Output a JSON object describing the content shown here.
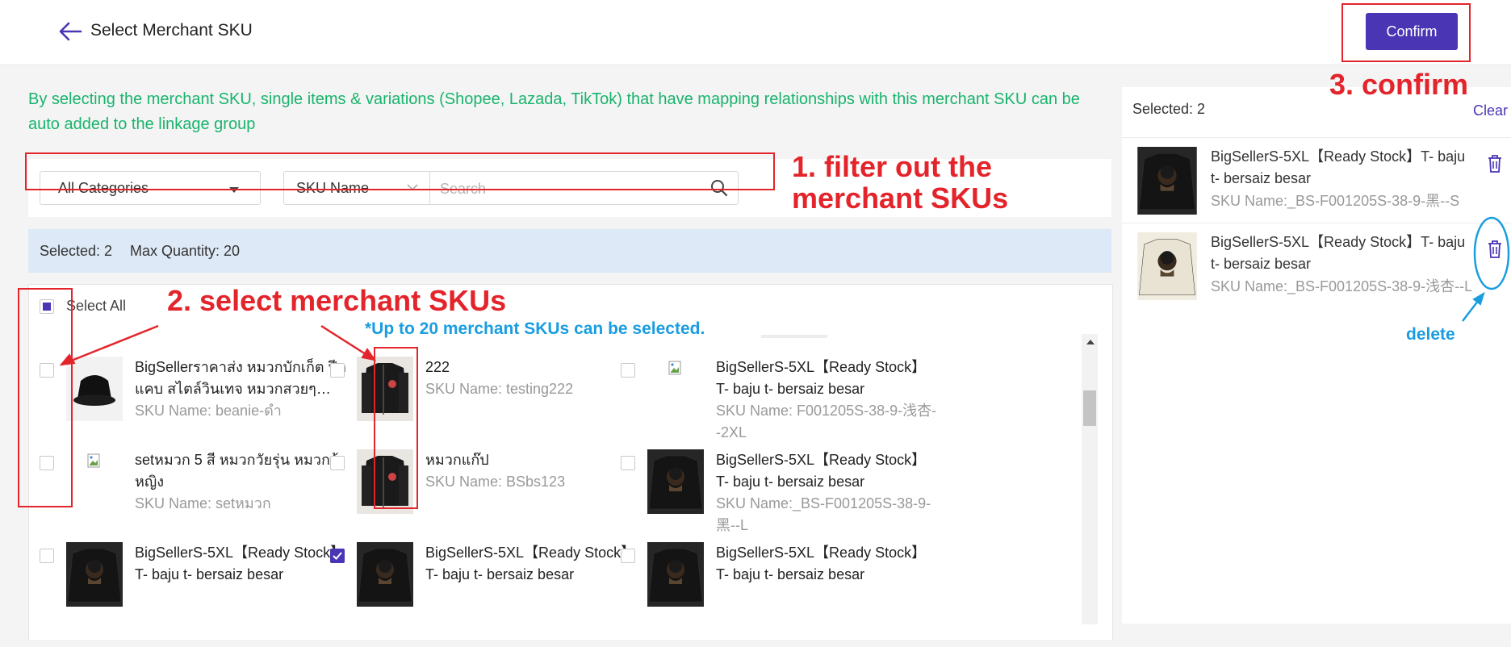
{
  "header": {
    "title": "Select Merchant SKU",
    "confirm_label": "Confirm"
  },
  "note": "By selecting the merchant SKU, single items & variations (Shopee, Lazada, TikTok) that have mapping relationships with this merchant SKU can be auto added to the linkage group",
  "filters": {
    "category": "All Categories",
    "search_type": "SKU Name",
    "search_placeholder": "Search"
  },
  "info_bar": {
    "selected": "Selected: 2",
    "max_quantity": "Max Quantity: 20"
  },
  "select_all_label": "Select All",
  "items": [
    {
      "name": "BigSellerราคาส่ง หมวกบักเก็ต ปีกแคบ สไตล์วินเทจ หมวกสวยๆ…",
      "sku": "SKU Name: beanie-ดำ",
      "checked": false,
      "thumb": "hat"
    },
    {
      "name": "222",
      "sku": "SKU Name: testing222",
      "checked": false,
      "thumb": "jacket"
    },
    {
      "name": "BigSellerS-5XL【Ready Stock】T- baju t- bersaiz besar",
      "sku": "SKU Name: F001205S-38-9-浅杏--2XL",
      "checked": false,
      "thumb": "broken"
    },
    {
      "name": "setหมวก 5 สี หมวกวัยรุ่น หมวกผู้หญิง",
      "sku": "SKU Name: setหมวก",
      "checked": false,
      "thumb": "broken"
    },
    {
      "name": "หมวกแก๊ป",
      "sku": "SKU Name: BSbs123",
      "checked": false,
      "thumb": "jacket"
    },
    {
      "name": "BigSellerS-5XL【Ready Stock】T- baju t- bersaiz besar",
      "sku": "SKU Name:_BS-F001205S-38-9-黑--L",
      "checked": false,
      "thumb": "shirt-black"
    },
    {
      "name": "BigSellerS-5XL【Ready Stock】T- baju t- bersaiz besar",
      "sku": "",
      "checked": false,
      "thumb": "shirt-black"
    },
    {
      "name": "BigSellerS-5XL【Ready Stock】T- baju t- bersaiz besar",
      "sku": "",
      "checked": true,
      "thumb": "shirt-black"
    },
    {
      "name": "BigSellerS-5XL【Ready Stock】T- baju t- bersaiz besar",
      "sku": "",
      "checked": false,
      "thumb": "shirt-black"
    }
  ],
  "selected_panel": {
    "count_label": "Selected: 2",
    "clear_label": "Clear",
    "items": [
      {
        "name": "BigSellerS-5XL【Ready Stock】T- baju t- bersaiz besar",
        "sku": "SKU Name:_BS-F001205S-38-9-黑--S",
        "thumb": "shirt-black"
      },
      {
        "name": "BigSellerS-5XL【Ready Stock】T- baju t- bersaiz besar",
        "sku": "SKU Name:_BS-F001205S-38-9-浅杏--L",
        "thumb": "shirt-cream"
      }
    ]
  },
  "annotations": {
    "step1_line1": "1. filter out the",
    "step1_line2": "merchant SKUs",
    "step2": "2. select merchant SKUs",
    "step2_note": "*Up to 20 merchant SKUs can be selected.",
    "step3": "3. confirm",
    "delete": "delete"
  },
  "colors": {
    "accent": "#4a35b5",
    "annotation_red": "#e3242b",
    "annotation_blue": "#1a9de0",
    "note_green": "#19b46c"
  }
}
